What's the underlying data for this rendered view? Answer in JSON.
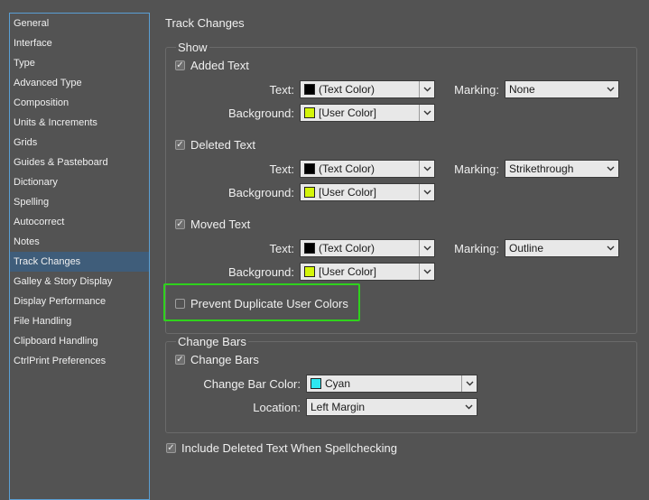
{
  "sidebar": {
    "items": [
      {
        "label": "General"
      },
      {
        "label": "Interface"
      },
      {
        "label": "Type"
      },
      {
        "label": "Advanced Type"
      },
      {
        "label": "Composition"
      },
      {
        "label": "Units & Increments"
      },
      {
        "label": "Grids"
      },
      {
        "label": "Guides & Pasteboard"
      },
      {
        "label": "Dictionary"
      },
      {
        "label": "Spelling"
      },
      {
        "label": "Autocorrect"
      },
      {
        "label": "Notes"
      },
      {
        "label": "Track Changes"
      },
      {
        "label": "Galley & Story Display"
      },
      {
        "label": "Display Performance"
      },
      {
        "label": "File Handling"
      },
      {
        "label": "Clipboard Handling"
      },
      {
        "label": "CtrlPrint Preferences"
      }
    ],
    "selected": "Track Changes"
  },
  "page": {
    "title": "Track Changes"
  },
  "show": {
    "legend": "Show",
    "added": {
      "checkbox_label": "Added Text",
      "checked": true,
      "text_label": "Text:",
      "text_value": "(Text Color)",
      "text_swatch": "#000000",
      "bg_label": "Background:",
      "bg_value": "[User Color]",
      "bg_swatch": "#d4f50a",
      "marking_label": "Marking:",
      "marking_value": "None"
    },
    "deleted": {
      "checkbox_label": "Deleted Text",
      "checked": true,
      "text_label": "Text:",
      "text_value": "(Text Color)",
      "text_swatch": "#000000",
      "bg_label": "Background:",
      "bg_value": "[User Color]",
      "bg_swatch": "#d4f50a",
      "marking_label": "Marking:",
      "marking_value": "Strikethrough"
    },
    "moved": {
      "checkbox_label": "Moved Text",
      "checked": true,
      "text_label": "Text:",
      "text_value": "(Text Color)",
      "text_swatch": "#000000",
      "bg_label": "Background:",
      "bg_value": "[User Color]",
      "bg_swatch": "#d4f50a",
      "marking_label": "Marking:",
      "marking_value": "Outline"
    },
    "prevent_duplicate": {
      "label": "Prevent Duplicate User Colors",
      "checked": false
    }
  },
  "change_bars": {
    "legend": "Change Bars",
    "checkbox_label": "Change Bars",
    "checked": true,
    "color_label": "Change Bar Color:",
    "color_value": "Cyan",
    "color_swatch": "#2ee8f0",
    "location_label": "Location:",
    "location_value": "Left Margin"
  },
  "spellcheck": {
    "label": "Include Deleted Text When Spellchecking",
    "checked": true
  },
  "colors": {
    "selection": "#3f5d7a",
    "highlight": "#2fd21c",
    "focus_border": "#5a9fd4"
  }
}
